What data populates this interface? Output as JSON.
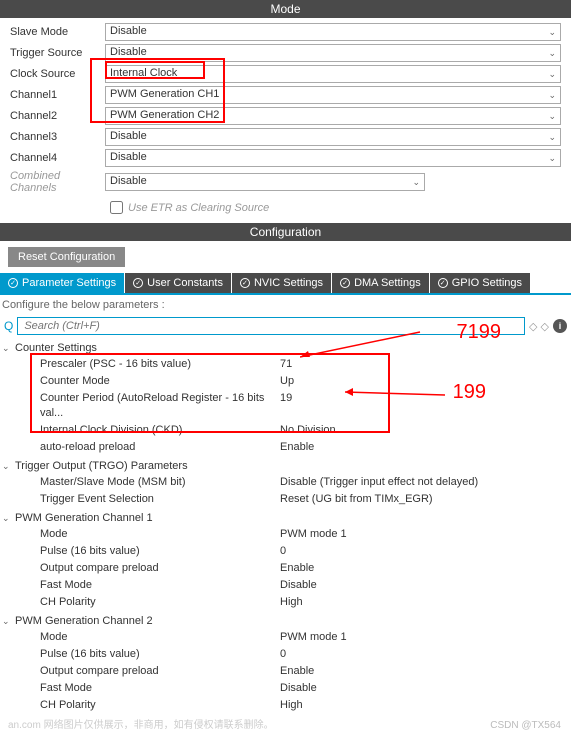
{
  "mode": {
    "title": "Mode",
    "rows": [
      {
        "label": "Slave Mode",
        "value": "Disable"
      },
      {
        "label": "Trigger Source",
        "value": "Disable"
      },
      {
        "label": "Clock Source",
        "value": "Internal Clock"
      },
      {
        "label": "Channel1",
        "value": "PWM Generation CH1"
      },
      {
        "label": "Channel2",
        "value": "PWM Generation CH2"
      },
      {
        "label": "Channel3",
        "value": "Disable"
      },
      {
        "label": "Channel4",
        "value": "Disable"
      },
      {
        "label": "Combined Channels",
        "value": "Disable",
        "disabled": true
      }
    ],
    "checkbox_label": "Use ETR as Clearing Source"
  },
  "configuration": {
    "title": "Configuration",
    "reset_button": "Reset Configuration",
    "tabs": [
      {
        "label": "Parameter Settings",
        "active": true
      },
      {
        "label": "User Constants"
      },
      {
        "label": "NVIC Settings"
      },
      {
        "label": "DMA Settings"
      },
      {
        "label": "GPIO Settings"
      }
    ],
    "hint": "Configure the below parameters :",
    "search_placeholder": "Search (Ctrl+F)"
  },
  "annotations": {
    "val1": "7199",
    "val2": "199"
  },
  "params": {
    "counter": {
      "title": "Counter Settings",
      "rows": [
        {
          "name": "Prescaler (PSC - 16 bits value)",
          "value": "71"
        },
        {
          "name": "Counter Mode",
          "value": "Up"
        },
        {
          "name": "Counter Period (AutoReload Register - 16 bits val...",
          "value": "19"
        },
        {
          "name": "Internal Clock Division (CKD)",
          "value": "No Division"
        },
        {
          "name": "auto-reload preload",
          "value": "Enable"
        }
      ]
    },
    "trgo": {
      "title": "Trigger Output (TRGO) Parameters",
      "rows": [
        {
          "name": "Master/Slave Mode (MSM bit)",
          "value": "Disable (Trigger input effect not delayed)"
        },
        {
          "name": "Trigger Event Selection",
          "value": "Reset (UG bit from TIMx_EGR)"
        }
      ]
    },
    "pwm1": {
      "title": "PWM Generation Channel 1",
      "rows": [
        {
          "name": "Mode",
          "value": "PWM mode 1"
        },
        {
          "name": "Pulse (16 bits value)",
          "value": "0"
        },
        {
          "name": "Output compare preload",
          "value": "Enable"
        },
        {
          "name": "Fast Mode",
          "value": "Disable"
        },
        {
          "name": "CH Polarity",
          "value": "High"
        }
      ]
    },
    "pwm2": {
      "title": "PWM Generation Channel 2",
      "rows": [
        {
          "name": "Mode",
          "value": "PWM mode 1"
        },
        {
          "name": "Pulse (16 bits value)",
          "value": "0"
        },
        {
          "name": "Output compare preload",
          "value": "Enable"
        },
        {
          "name": "Fast Mode",
          "value": "Disable"
        },
        {
          "name": "CH Polarity",
          "value": "High"
        }
      ]
    }
  },
  "footer": {
    "watermark": "网络图片仅供展示，非商用，如有侵权请联系删除。",
    "watermark_prefix": "an.com",
    "attribution": "CSDN @TX564"
  }
}
